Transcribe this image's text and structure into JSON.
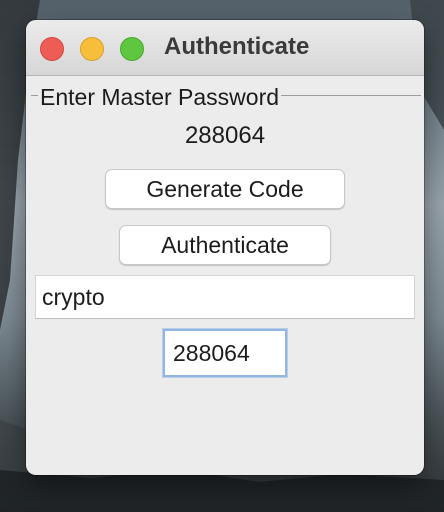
{
  "window": {
    "title": "Authenticate"
  },
  "group": {
    "legend": "Enter Master Password"
  },
  "code_display": "288064",
  "buttons": {
    "generate_label": "Generate Code",
    "authenticate_label": "Authenticate"
  },
  "fields": {
    "password_value": "crypto",
    "code_value": "288064"
  },
  "colors": {
    "close": "#ee5d55",
    "minimize": "#f6be3b",
    "zoom": "#5ec73f",
    "focus_ring": "#94b5df"
  }
}
